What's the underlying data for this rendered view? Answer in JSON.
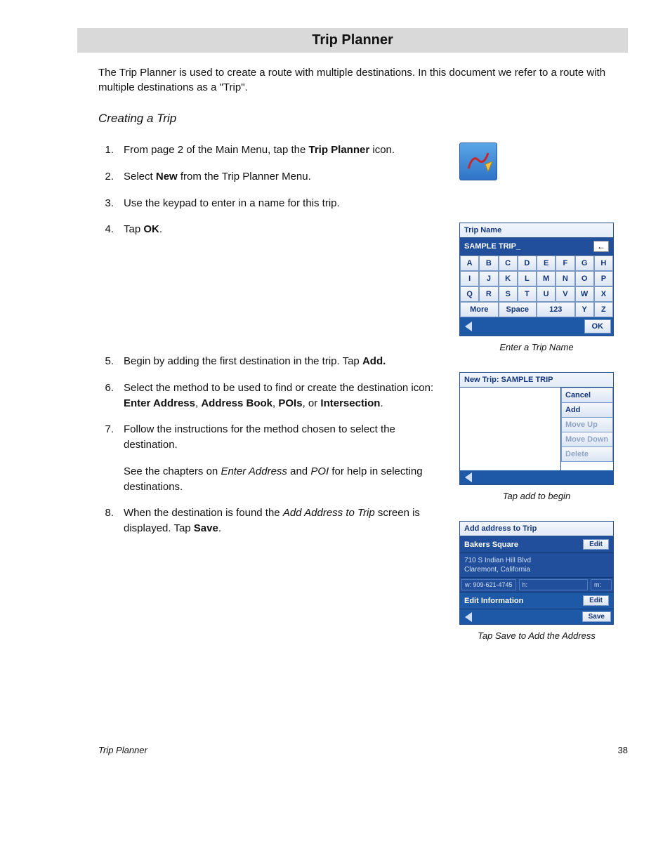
{
  "title": "Trip Planner",
  "intro": "The Trip Planner is used to create a route with multiple destinations.  In this document we refer to a route with multiple destinations as a \"Trip\".",
  "section_heading": "Creating a Trip",
  "steps": {
    "s1": {
      "num": "1.",
      "pre": "From page 2 of the Main Menu, tap the ",
      "bold": "Trip Planner",
      "post": " icon."
    },
    "s2": {
      "num": "2.",
      "pre": "Select ",
      "bold": "New",
      "post": " from the Trip Planner Menu."
    },
    "s3": {
      "num": "3.",
      "body": "Use the keypad to enter in a name for this trip."
    },
    "s4": {
      "num": "4.",
      "pre": "Tap ",
      "bold": "OK",
      "post": "."
    },
    "s5": {
      "num": "5.",
      "pre": "Begin by adding the first destination in the trip.  Tap ",
      "bold": "Add.",
      "post": ""
    },
    "s6": {
      "num": "6.",
      "pre": "Select the method to be used to find or create the destination icon: ",
      "b1": "Enter Address",
      "c1": ", ",
      "b2": "Address Book",
      "c2": ", ",
      "b3": "POIs",
      "c3": ", or ",
      "b4": "Intersection",
      "post": "."
    },
    "s7": {
      "num": "7.",
      "body": "Follow the instructions for the method chosen to select the destination."
    },
    "sub7": {
      "pre": "See the chapters on ",
      "i1": "Enter Address",
      "mid": " and ",
      "i2": "POI",
      "post": " for help in selecting destinations."
    },
    "s8": {
      "num": "8.",
      "pre": "When the destination is found the ",
      "i1": "Add Address to Trip",
      "mid": " screen is displayed.  Tap ",
      "bold": "Save",
      "post": "."
    }
  },
  "kb": {
    "header": "Trip Name",
    "text": "SAMPLE TRIP_",
    "keys_row1": [
      "A",
      "B",
      "C",
      "D",
      "E",
      "F",
      "G",
      "H"
    ],
    "keys_row2": [
      "I",
      "J",
      "K",
      "L",
      "M",
      "N",
      "O",
      "P"
    ],
    "keys_row3": [
      "Q",
      "R",
      "S",
      "T",
      "U",
      "V",
      "W",
      "X"
    ],
    "more": "More",
    "space": "Space",
    "n123": "123",
    "y": "Y",
    "z": "Z",
    "ok": "OK",
    "caption": "Enter a Trip Name"
  },
  "trip_panel": {
    "header": "New Trip: SAMPLE TRIP",
    "btns": {
      "cancel": "Cancel",
      "add": "Add",
      "up": "Move Up",
      "down": "Move Down",
      "del": "Delete"
    },
    "caption": "Tap add to begin"
  },
  "addr_panel": {
    "header": "Add address to Trip",
    "name": "Bakers Square",
    "edit": "Edit",
    "address_l1": "710 S Indian Hill Blvd",
    "address_l2": "Claremont, California",
    "phone_w": "w: 909-621-4745",
    "phone_h": "h:",
    "phone_m": "m:",
    "info": "Edit Information",
    "save": "Save",
    "caption": "Tap Save to Add the Address"
  },
  "footer": {
    "chapter": "Trip Planner",
    "page": "38"
  }
}
